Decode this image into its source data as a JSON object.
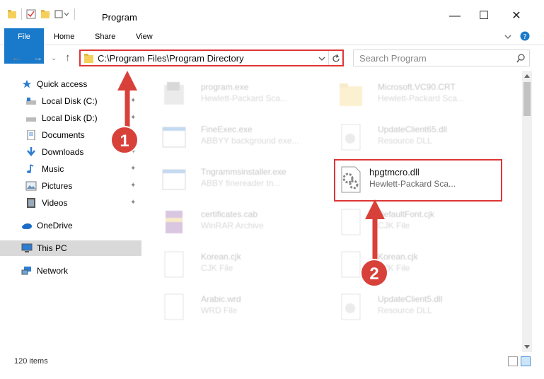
{
  "window": {
    "title": "Program"
  },
  "ribbon": {
    "file": "File",
    "home": "Home",
    "share": "Share",
    "view": "View"
  },
  "address": {
    "path": "C:\\Program Files\\Program Directory"
  },
  "search": {
    "placeholder": "Search Program"
  },
  "nav": {
    "quick_access": "Quick access",
    "local_c": "Local Disk (C:)",
    "local_d": "Local Disk (D:)",
    "documents": "Documents",
    "downloads": "Downloads",
    "music": "Music",
    "pictures": "Pictures",
    "videos": "Videos",
    "onedrive": "OneDrive",
    "thispc": "This PC",
    "network": "Network"
  },
  "files": [
    {
      "name": "program.exe",
      "type": "Hewlett-Packard Sca..."
    },
    {
      "name": "Microsoft.VC90.CRT",
      "type": "Hewlett-Packard Sca..."
    },
    {
      "name": "FineExec.exe",
      "type": "ABBYY background exe..."
    },
    {
      "name": "UpdateClient65.dll",
      "type": "Resource DLL"
    },
    {
      "name": "Tngrammsinstaller.exe",
      "type": "ABBY finereader tn..."
    },
    {
      "name": "hpgtmcro.dll",
      "type": "Hewlett-Packard Sca..."
    },
    {
      "name": "certificates.cab",
      "type": "WinRAR Archive"
    },
    {
      "name": "DefaultFont.cjk",
      "type": "CJK File"
    },
    {
      "name": "Korean.cjk",
      "type": "CJK File"
    },
    {
      "name": "Korean.cjk",
      "type": "CJK File"
    },
    {
      "name": "Arabic.wrd",
      "type": "WRD File"
    },
    {
      "name": "UpdateClient5.dll",
      "type": "Resource DLL"
    }
  ],
  "status": {
    "count": "120 items"
  },
  "annotations": {
    "step1": "1",
    "step2": "2"
  },
  "colors": {
    "accent": "#1979ca",
    "highlight": "#e03535",
    "badge": "#d8413a"
  }
}
